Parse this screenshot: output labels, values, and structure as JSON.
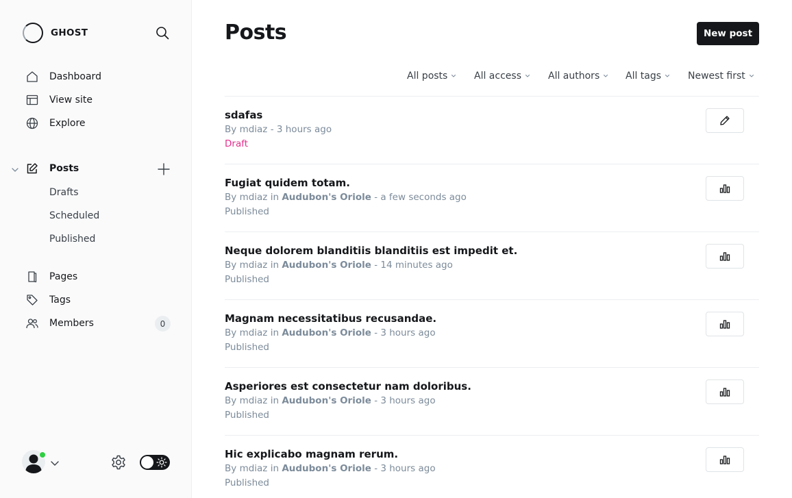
{
  "brand": {
    "name": "GHOST"
  },
  "sidebar": {
    "items": [
      {
        "label": "Dashboard",
        "icon": "home-icon"
      },
      {
        "label": "View site",
        "icon": "layout-icon"
      },
      {
        "label": "Explore",
        "icon": "globe-icon"
      },
      {
        "label": "Posts",
        "icon": "edit-icon"
      },
      {
        "label": "Pages",
        "icon": "page-icon"
      },
      {
        "label": "Tags",
        "icon": "tag-icon"
      },
      {
        "label": "Members",
        "icon": "members-icon",
        "badge": "0"
      }
    ],
    "post_subitems": [
      "Drafts",
      "Scheduled",
      "Published"
    ]
  },
  "main": {
    "title": "Posts",
    "new_post_label": "New post",
    "filters": [
      "All posts",
      "All access",
      "All authors",
      "All tags",
      "Newest first"
    ]
  },
  "posts": [
    {
      "title": "sdafas",
      "author": "mdiaz",
      "tag": "",
      "time": "3 hours ago",
      "status": "Draft",
      "action": "edit-icon"
    },
    {
      "title": "Fugiat quidem totam.",
      "author": "mdiaz",
      "tag": "Audubon's Oriole",
      "time": "a few seconds ago",
      "status": "Published",
      "action": "analytics-icon"
    },
    {
      "title": "Neque dolorem blanditiis blanditiis est impedit et.",
      "author": "mdiaz",
      "tag": "Audubon's Oriole",
      "time": "14 minutes ago",
      "status": "Published",
      "action": "analytics-icon"
    },
    {
      "title": "Magnam necessitatibus recusandae.",
      "author": "mdiaz",
      "tag": "Audubon's Oriole",
      "time": "3 hours ago",
      "status": "Published",
      "action": "analytics-icon"
    },
    {
      "title": "Asperiores est consectetur nam doloribus.",
      "author": "mdiaz",
      "tag": "Audubon's Oriole",
      "time": "3 hours ago",
      "status": "Published",
      "action": "analytics-icon"
    },
    {
      "title": "Hic explicabo magnam rerum.",
      "author": "mdiaz",
      "tag": "Audubon's Oriole",
      "time": "3 hours ago",
      "status": "Published",
      "action": "analytics-icon"
    }
  ],
  "strings": {
    "by": "By",
    "in": "in",
    "sep": "-"
  },
  "colors": {
    "accent_dark": "#15171a",
    "draft": "#e52e8c",
    "online": "#30cf43",
    "muted": "#7c8b9a"
  }
}
